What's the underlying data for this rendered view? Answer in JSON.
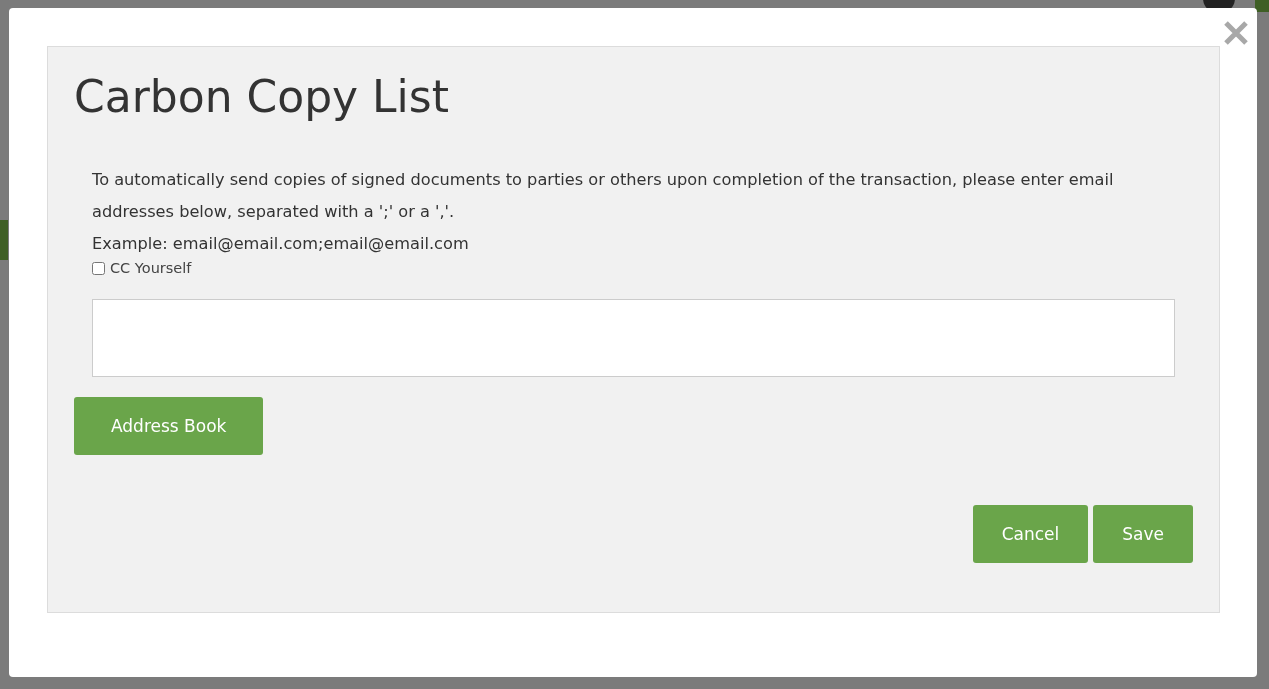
{
  "dialog": {
    "title": "Carbon Copy List",
    "instructions": [
      "To automatically send copies of signed documents to parties or others upon completion of the transaction, please enter email addresses below, separated with a ';' or a ','.",
      "Example: email@email.com;email@email.com"
    ],
    "cc_yourself": {
      "label": "CC Yourself",
      "checked": false
    },
    "address_book_button": "Address Book",
    "buttons": [
      "Cancel",
      "Save"
    ]
  }
}
